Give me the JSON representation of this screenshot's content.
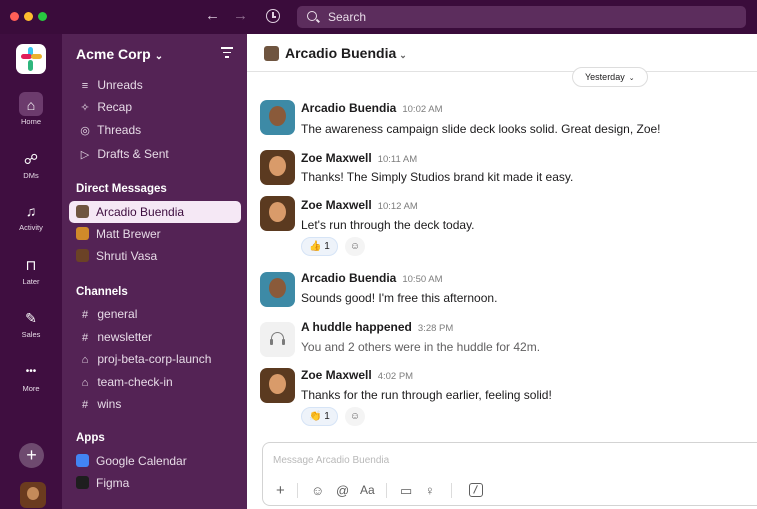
{
  "titlebar": {
    "back_icon": "←",
    "forward_icon": "→",
    "search_placeholder": "Search"
  },
  "rail": {
    "items": [
      {
        "label": "Home",
        "icon": "home-icon",
        "glyph": "⌂"
      },
      {
        "label": "DMs",
        "icon": "dms-icon",
        "glyph": "☍"
      },
      {
        "label": "Activity",
        "icon": "bell-icon",
        "glyph": "♫"
      },
      {
        "label": "Later",
        "icon": "bookmark-icon",
        "glyph": "⊓"
      },
      {
        "label": "Sales",
        "icon": "edit-icon",
        "glyph": "✎"
      },
      {
        "label": "More",
        "icon": "more-icon",
        "glyph": "•••"
      }
    ],
    "add_glyph": "+"
  },
  "sidebar": {
    "workspace": "Acme Corp",
    "workspace_caret": "⌄",
    "nav": [
      {
        "label": "Unreads",
        "glyph": "≡"
      },
      {
        "label": "Recap",
        "glyph": "✧"
      },
      {
        "label": "Threads",
        "glyph": "◎"
      },
      {
        "label": "Drafts & Sent",
        "glyph": "▷"
      }
    ],
    "dm_heading": "Direct Messages",
    "dms": [
      {
        "label": "Arcadio Buendia",
        "color": "#6f5540"
      },
      {
        "label": "Matt Brewer",
        "color": "#d08a2a"
      },
      {
        "label": "Shruti Vasa",
        "color": "#6b4226"
      }
    ],
    "channels_heading": "Channels",
    "channels": [
      {
        "label": "general",
        "glyph": "#"
      },
      {
        "label": "newsletter",
        "glyph": "#"
      },
      {
        "label": "proj-beta-corp-launch",
        "glyph": "⌂"
      },
      {
        "label": "team-check-in",
        "glyph": "⌂"
      },
      {
        "label": "wins",
        "glyph": "#"
      }
    ],
    "apps_heading": "Apps",
    "apps": [
      {
        "label": "Google Calendar",
        "color": "#4285f4"
      },
      {
        "label": "Figma",
        "color": "#1e1e1e"
      }
    ]
  },
  "channel": {
    "title": "Arcadio Buendia",
    "caret": "⌄",
    "date_divider": "Yesterday",
    "date_caret": "⌄"
  },
  "messages": [
    {
      "author": "Arcadio Buendia",
      "time": "10:02 AM",
      "text": "The awareness campaign slide deck looks solid. Great design, Zoe!"
    },
    {
      "author": "Zoe Maxwell",
      "time": "10:11 AM",
      "text": "Thanks! The Simply Studios brand kit made it easy."
    },
    {
      "author": "Zoe Maxwell",
      "time": "10:12 AM",
      "text": "Let's run through the deck today.",
      "reaction": {
        "emoji": "👍",
        "count": "1"
      }
    },
    {
      "author": "Arcadio Buendia",
      "time": "10:50 AM",
      "text": "Sounds good! I'm free this afternoon."
    },
    {
      "author": "A huddle happened",
      "time": "3:28 PM",
      "text": "You and 2 others were in the huddle for 42m."
    },
    {
      "author": "Zoe Maxwell",
      "time": "4:02 PM",
      "text": "Thanks for the run through earlier, feeling solid!",
      "reaction": {
        "emoji": "👏",
        "count": "1"
      }
    }
  ],
  "reaction_add_glyph": "☺",
  "composer": {
    "placeholder": "Message Arcadio Buendia",
    "tools": {
      "plus": "+",
      "emoji": "☺",
      "mention": "@",
      "format": "Aa",
      "video": "▭",
      "mic": "♀"
    }
  }
}
